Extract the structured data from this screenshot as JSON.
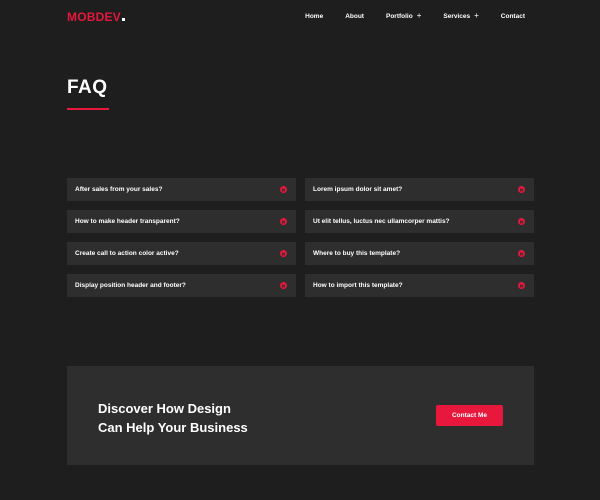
{
  "header": {
    "logo": "MOBDEV",
    "nav": [
      {
        "label": "Home",
        "has_submenu": false
      },
      {
        "label": "About",
        "has_submenu": false
      },
      {
        "label": "Portfolio",
        "has_submenu": true
      },
      {
        "label": "Services",
        "has_submenu": true
      },
      {
        "label": "Contact",
        "has_submenu": false
      }
    ],
    "submenu_symbol": "+"
  },
  "page": {
    "title": "FAQ"
  },
  "faq": {
    "left": [
      "After sales from your sales?",
      "How to make header transparent?",
      "Create call to action color active?",
      "Display position header and footer?"
    ],
    "right": [
      "Lorem ipsum dolor sit amet?",
      "Ut elit tellus, luctus nec ullamcorper mattis?",
      "Where to buy this template?",
      "How to import this template?"
    ]
  },
  "cta": {
    "heading_line1": "Discover How Design",
    "heading_line2": "Can Help Your Business",
    "button_label": "Contact Me"
  },
  "colors": {
    "accent": "#e8173c",
    "background": "#1e1e1e",
    "panel": "#2e2e2e",
    "text": "#ffffff"
  }
}
